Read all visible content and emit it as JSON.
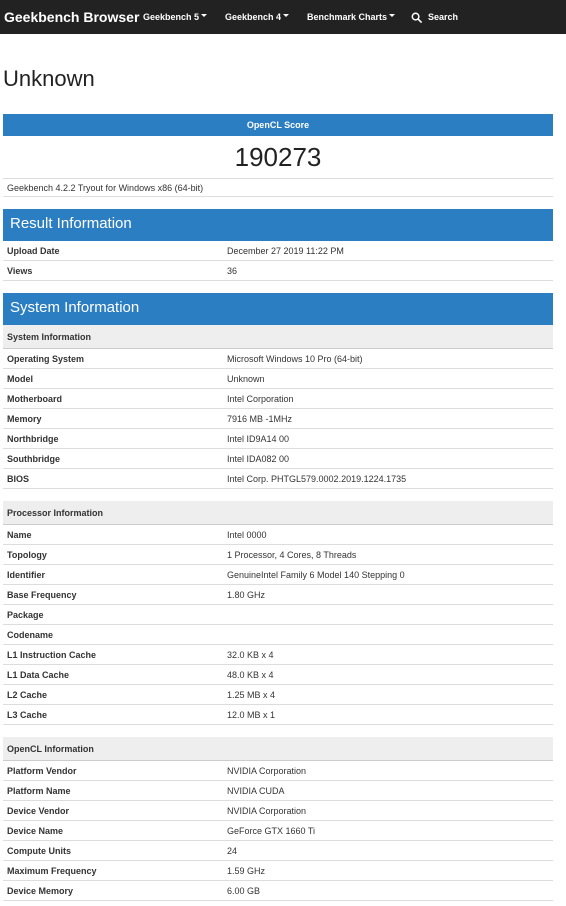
{
  "navbar": {
    "brand": "Geekbench Browser",
    "items": [
      {
        "label": "Geekbench 5"
      },
      {
        "label": "Geekbench 4"
      },
      {
        "label": "Benchmark Charts"
      }
    ],
    "search_label": "Search"
  },
  "page": {
    "title": "Unknown"
  },
  "score": {
    "header": "OpenCL Score",
    "value": "190273",
    "note": "Geekbench 4.2.2 Tryout for Windows x86 (64-bit)"
  },
  "result_info": {
    "header": "Result Information",
    "rows": [
      {
        "k": "Upload Date",
        "v": "December 27 2019 11:22 PM"
      },
      {
        "k": "Views",
        "v": "36"
      }
    ]
  },
  "system_info": {
    "header": "System Information",
    "groups": [
      {
        "title": "System Information",
        "rows": [
          {
            "k": "Operating System",
            "v": "Microsoft Windows 10 Pro (64-bit)"
          },
          {
            "k": "Model",
            "v": "Unknown"
          },
          {
            "k": "Motherboard",
            "v": "Intel Corporation"
          },
          {
            "k": "Memory",
            "v": "7916 MB -1MHz"
          },
          {
            "k": "Northbridge",
            "v": "Intel ID9A14 00"
          },
          {
            "k": "Southbridge",
            "v": "Intel IDA082 00"
          },
          {
            "k": "BIOS",
            "v": "Intel Corp. PHTGL579.0002.2019.1224.1735"
          }
        ]
      },
      {
        "title": "Processor Information",
        "rows": [
          {
            "k": "Name",
            "v": "Intel 0000"
          },
          {
            "k": "Topology",
            "v": "1 Processor, 4 Cores, 8 Threads"
          },
          {
            "k": "Identifier",
            "v": "GenuineIntel Family 6 Model 140 Stepping 0"
          },
          {
            "k": "Base Frequency",
            "v": "1.80 GHz"
          },
          {
            "k": "Package",
            "v": ""
          },
          {
            "k": "Codename",
            "v": ""
          },
          {
            "k": "L1 Instruction Cache",
            "v": "32.0 KB x 4"
          },
          {
            "k": "L1 Data Cache",
            "v": "48.0 KB x 4"
          },
          {
            "k": "L2 Cache",
            "v": "1.25 MB x 4"
          },
          {
            "k": "L3 Cache",
            "v": "12.0 MB x 1"
          }
        ]
      },
      {
        "title": "OpenCL Information",
        "rows": [
          {
            "k": "Platform Vendor",
            "v": "NVIDIA Corporation"
          },
          {
            "k": "Platform Name",
            "v": "NVIDIA CUDA"
          },
          {
            "k": "Device Vendor",
            "v": "NVIDIA Corporation"
          },
          {
            "k": "Device Name",
            "v": "GeForce GTX 1660 Ti"
          },
          {
            "k": "Compute Units",
            "v": "24"
          },
          {
            "k": "Maximum Frequency",
            "v": "1.59 GHz"
          },
          {
            "k": "Device Memory",
            "v": "6.00 GB"
          }
        ]
      }
    ]
  }
}
